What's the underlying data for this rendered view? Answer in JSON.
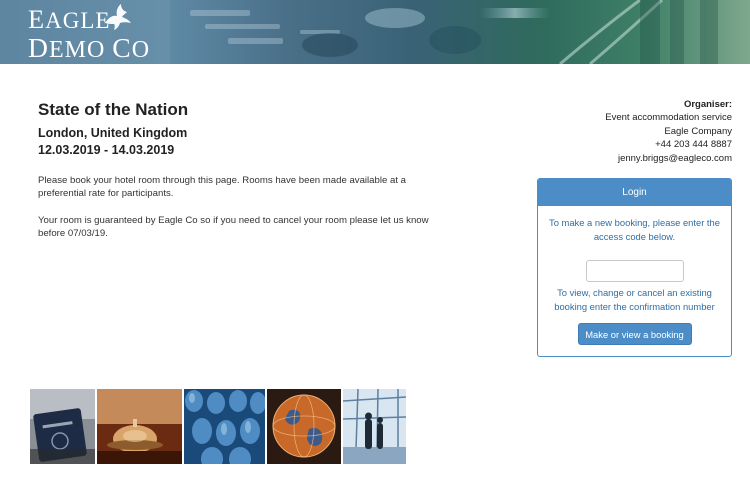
{
  "branding": {
    "logo_line1": "Eagle",
    "logo_line2": "Demo Co",
    "logo_icon": "eagle-icon"
  },
  "event": {
    "title": "State of the Nation",
    "location": "London, United Kingdom",
    "dates": "12.03.2019 - 14.03.2019",
    "paragraph1": "Please book your hotel room through this page. Rooms have been made available at a preferential rate for participants.",
    "paragraph2": "Your room is guaranteed by Eagle Co so if you need to cancel your room please let us know before 07/03/19."
  },
  "organiser": {
    "heading": "Organiser:",
    "service": "Event accommodation service",
    "company": "Eagle Company",
    "phone": "+44 203 444 8887",
    "email": "jenny.briggs@eagleco.com"
  },
  "login": {
    "title": "Login",
    "new_booking_text": "To make a new booking, please enter the access code below.",
    "code_value": "",
    "existing_booking_text": "To view, change or cancel an existing booking enter the confirmation number",
    "button_label": "Make or view a booking"
  },
  "photos": [
    {
      "subject": "passport-photo"
    },
    {
      "subject": "reception-bell-photo"
    },
    {
      "subject": "conference-seats-photo"
    },
    {
      "subject": "globe-photo"
    },
    {
      "subject": "airport-travellers-photo"
    }
  ],
  "colors": {
    "accent": "#4c8dc8",
    "link_text": "#2e6ea6"
  }
}
